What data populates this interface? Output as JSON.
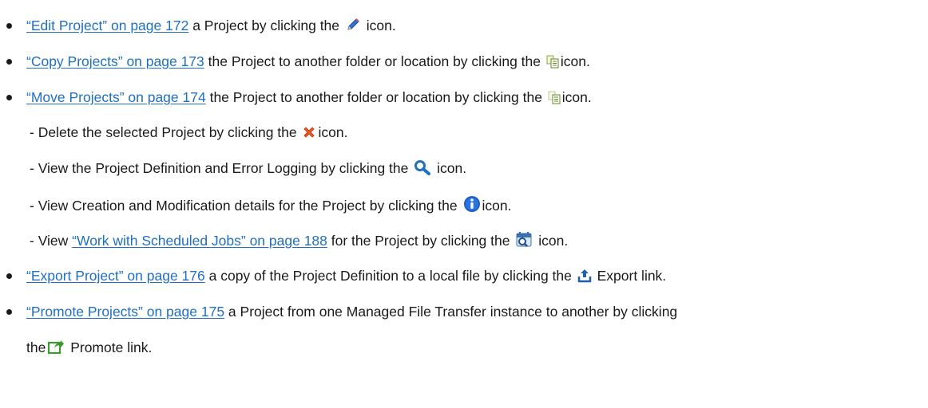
{
  "items": [
    {
      "link": "“Edit Project” on page 172",
      "text": " a Project by clicking the ",
      "icon": "pencil-icon",
      "after": " icon."
    },
    {
      "link": "“Copy Projects” on page 173",
      "text": " the Project to another folder or location by clicking the ",
      "icon": "copy-icon",
      "after": "icon."
    },
    {
      "link": "“Move Projects” on page 174",
      "text": " the Project to another folder or location by clicking the ",
      "icon": "move-icon",
      "after": "icon."
    },
    {
      "text": "- Delete the selected Project by clicking the ",
      "icon": "delete-x-icon",
      "after": "icon."
    },
    {
      "text": "- View the Project Definition and Error Logging by clicking the ",
      "icon": "magnifier-icon",
      "after": " icon."
    },
    {
      "text": "- View Creation and Modification details for the Project by clicking the ",
      "icon": "info-icon",
      "after": "icon."
    },
    {
      "prefix": "- View ",
      "link": "“Work with Scheduled Jobs” on page 188",
      "text": " for the Project by clicking the ",
      "icon": "scheduled-jobs-icon",
      "after": " icon."
    },
    {
      "link": "“Export Project” on page 176",
      "text": " a copy of the Project Definition to a local file by clicking the ",
      "icon": "export-icon",
      "after": " Export link."
    },
    {
      "link": "“Promote Projects” on page 175",
      "text": " a Project from one Managed File Transfer instance to another by clicking",
      "line2_prefix": "the",
      "icon": "promote-icon",
      "after": " Promote link."
    }
  ]
}
